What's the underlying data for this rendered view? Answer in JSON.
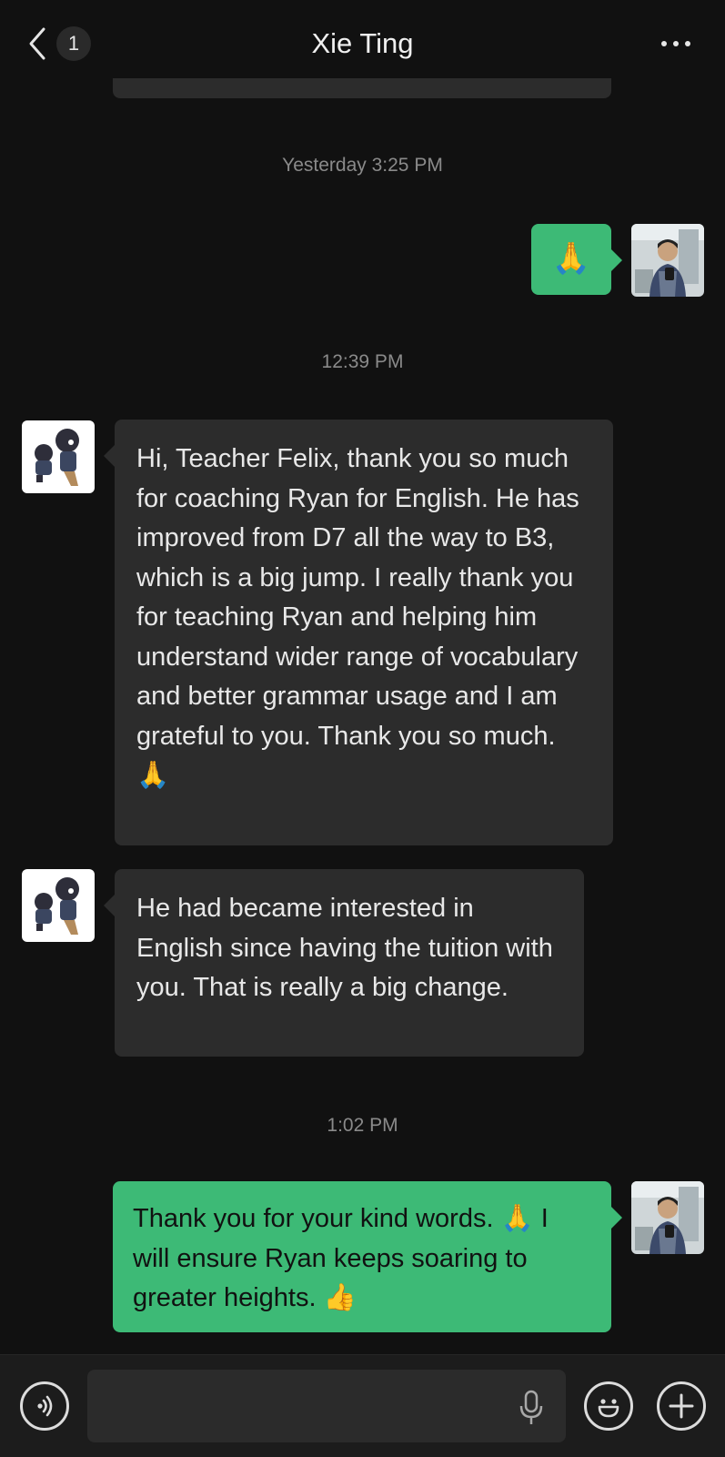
{
  "header": {
    "title": "Xie Ting",
    "unread_count": "1",
    "back_icon": "chevron-left-icon",
    "more_icon": "more-dots-icon"
  },
  "messages": [
    {
      "type": "timestamp",
      "text": "Yesterday 3:25 PM"
    },
    {
      "type": "outgoing",
      "text": "🙏"
    },
    {
      "type": "timestamp",
      "text": "12:39 PM"
    },
    {
      "type": "incoming",
      "text": "Hi, Teacher Felix, thank you so much for coaching Ryan for English. He has improved from D7 all the way to B3, which is a big jump. I really thank you for teaching Ryan and helping him understand wider range of vocabulary and better grammar usage and I am grateful to you. Thank you so much. 🙏"
    },
    {
      "type": "incoming",
      "text": "He had became interested in English since having the tuition with you. That is really a big change."
    },
    {
      "type": "timestamp",
      "text": "1:02 PM"
    },
    {
      "type": "outgoing",
      "text": "Thank you for your kind words. 🙏 I will ensure Ryan keeps soaring to greater heights. 👍"
    }
  ],
  "input_bar": {
    "placeholder": "",
    "voice_icon": "voice-icon",
    "mic_icon": "microphone-icon",
    "emoji_icon": "emoji-icon",
    "plus_icon": "plus-icon"
  },
  "colors": {
    "background": "#111111",
    "incoming_bubble": "#2c2c2c",
    "outgoing_bubble": "#3dba76"
  }
}
